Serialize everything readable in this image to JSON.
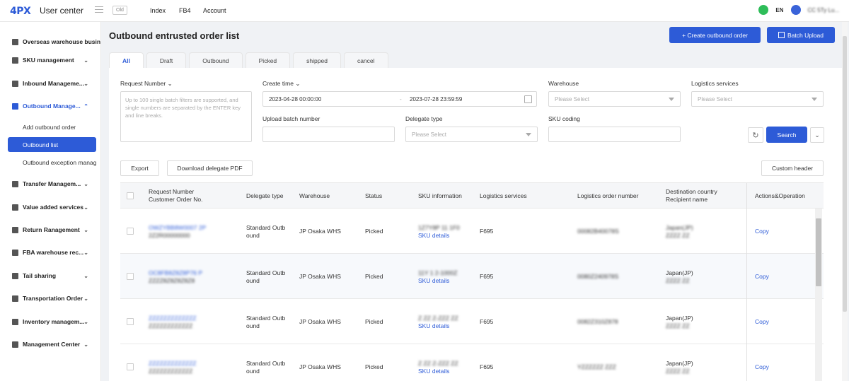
{
  "header": {
    "logo": "4PX",
    "app_title": "User center",
    "old_badge": "Old",
    "nav": [
      "Index",
      "FB4",
      "Account"
    ],
    "lang": "EN",
    "user_name": "CC 5Ty Lu..."
  },
  "sidebar": {
    "items": [
      {
        "label": "Overseas warehouse busin",
        "icon": "home-icon"
      },
      {
        "label": "SKU management",
        "icon": "box-icon"
      },
      {
        "label": "Inbound Manageme...",
        "icon": "inbound-icon"
      },
      {
        "label": "Outbound Manage...",
        "icon": "outbound-icon"
      },
      {
        "label": "Transfer Managem...",
        "icon": "transfer-icon"
      },
      {
        "label": "Value added services",
        "icon": "service-icon"
      },
      {
        "label": "Return Ranagement",
        "icon": "return-icon"
      },
      {
        "label": "FBA warehouse rec...",
        "icon": "fba-icon"
      },
      {
        "label": "Tail sharing",
        "icon": "share-icon"
      },
      {
        "label": "Transportation Order",
        "icon": "truck-icon"
      },
      {
        "label": "Inventory managem...",
        "icon": "inventory-icon"
      },
      {
        "label": "Management Center",
        "icon": "center-icon"
      }
    ],
    "sub_items": [
      "Add outbound order",
      "Outbound list",
      "Outbound exception manag"
    ]
  },
  "main": {
    "title": "Outbound entrusted order list",
    "create_btn": "+ Create outbound order",
    "batch_btn": "Batch Upload",
    "tabs": [
      "All",
      "Draft",
      "Outbound",
      "Picked",
      "shipped",
      "cancel"
    ]
  },
  "filters": {
    "request_number_label": "Request Number",
    "request_number_placeholder": "Up to 100 single batch filters are supported, and single numbers are separated by the ENTER key and line breaks.",
    "create_time_label": "Create time",
    "date_from": "2023-04-28 00:00:00",
    "date_sep": "-",
    "date_to": "2023-07-28 23:59:59",
    "warehouse_label": "Warehouse",
    "warehouse_placeholder": "Please Select",
    "logistics_label": "Logistics services",
    "logistics_placeholder": "Please Select",
    "upload_batch_label": "Upload batch number",
    "delegate_type_label": "Delegate type",
    "delegate_type_placeholder": "Please Select",
    "sku_coding_label": "SKU coding",
    "search_btn": "Search"
  },
  "toolbar": {
    "export": "Export",
    "download_pdf": "Download delegate PDF",
    "custom_header": "Custom header"
  },
  "table": {
    "headers": {
      "request_number": "Request Number",
      "customer_order": "Customer Order No.",
      "delegate_type": "Delegate type",
      "warehouse": "Warehouse",
      "status": "Status",
      "sku_info": "SKU information",
      "logistics_services": "Logistics services",
      "logistics_order": "Logistics order number",
      "destination": "Destination country",
      "recipient": "Recipient name",
      "actions": "Actions&Operation"
    },
    "rows": [
      {
        "req": "OWZYBB8W0007 2P",
        "cust": "2Z2R00000000",
        "delegate_1": "Standard Outb",
        "delegate_2": "ound",
        "warehouse": "JP Osaka WHS",
        "status": "Picked",
        "sku": "1Z7Y8P 11 1F0",
        "sku_link": "SKU details",
        "logistics": "F695",
        "order": "00082B40078S",
        "dest": "Japan(JP)",
        "recipient": "ZZZZ ZZ",
        "action": "Copy"
      },
      {
        "req": "OC8FB8Z8Z8P76 P",
        "cust": "ZZZZ8Z8Z8Z8Z8",
        "delegate_1": "Standard Outb",
        "delegate_2": "ound",
        "warehouse": "JP Osaka WHS",
        "status": "Picked",
        "sku": "11Y 1 2-1000Z",
        "sku_link": "SKU details",
        "logistics": "F695",
        "order": "0080Z240978S",
        "dest": "Japan(JP)",
        "recipient": "ZZZZ ZZ",
        "action": "Copy"
      },
      {
        "req": "ZZZZZZZZZZZZZ",
        "cust": "ZZZZZZZZZZZZ",
        "delegate_1": "Standard Outb",
        "delegate_2": "ound",
        "warehouse": "JP Osaka WHS",
        "status": "Picked",
        "sku": "Z ZZ Z-ZZZ ZZ",
        "sku_link": "SKU details",
        "logistics": "F695",
        "order": "0082Z310Z878",
        "dest": "Japan(JP)",
        "recipient": "ZZZZ ZZ",
        "action": "Copy"
      },
      {
        "req": "ZZZZZZZZZZZZZ",
        "cust": "ZZZZZZZZZZZZ",
        "delegate_1": "Standard Outb",
        "delegate_2": "ound",
        "warehouse": "JP Osaka WHS",
        "status": "Picked",
        "sku": "Z ZZ Z-ZZZ ZZ",
        "sku_link": "SKU details",
        "logistics": "F695",
        "order": "YZZZZZZ ZZZ",
        "dest": "Japan(JP)",
        "recipient": "ZZZZ ZZ",
        "action": "Copy"
      }
    ]
  }
}
